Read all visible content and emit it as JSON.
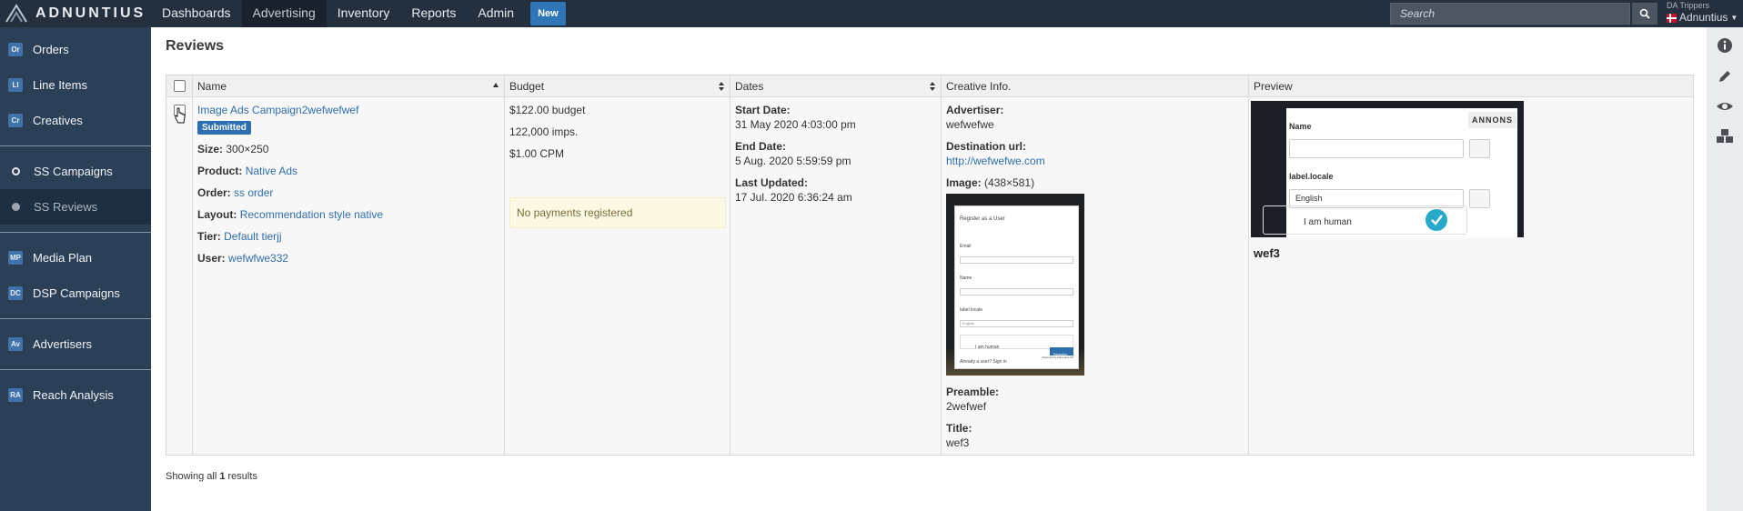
{
  "brand": {
    "name": "ADNUNTIUS"
  },
  "nav": {
    "items": [
      "Dashboards",
      "Advertising",
      "Inventory",
      "Reports",
      "Admin"
    ],
    "new_label": "New"
  },
  "search": {
    "placeholder": "Search"
  },
  "network": {
    "label": "DA Trippers",
    "name": "Adnuntius"
  },
  "sidebar": {
    "group1": [
      {
        "abbr": "Or",
        "label": "Orders"
      },
      {
        "abbr": "LI",
        "label": "Line Items"
      },
      {
        "abbr": "Cr",
        "label": "Creatives"
      }
    ],
    "group2": [
      {
        "label": "SS Campaigns"
      },
      {
        "label": "SS Reviews"
      }
    ],
    "group3": [
      {
        "abbr": "MP",
        "label": "Media Plan"
      },
      {
        "abbr": "DC",
        "label": "DSP Campaigns"
      }
    ],
    "group4": [
      {
        "abbr": "Av",
        "label": "Advertisers"
      }
    ],
    "group5": [
      {
        "abbr": "RA",
        "label": "Reach Analysis"
      }
    ]
  },
  "page": {
    "title": "Reviews"
  },
  "table": {
    "headers": {
      "name": "Name",
      "budget": "Budget",
      "dates": "Dates",
      "creative": "Creative Info.",
      "preview": "Preview"
    },
    "row": {
      "name": "Image Ads Campaign2wefwefwef",
      "status": "Submitted",
      "size_label": "Size:",
      "size": "300×250",
      "product_label": "Product:",
      "product": "Native Ads",
      "order_label": "Order:",
      "order": "ss order",
      "layout_label": "Layout:",
      "layout": "Recommendation style native",
      "tier_label": "Tier:",
      "tier": "Default tierjj",
      "user_label": "User:",
      "user": "wefwfwe332",
      "budget": "$122.00 budget",
      "imps": "122,000 imps.",
      "cpm": "$1.00 CPM",
      "payments": "No payments registered",
      "start_label": "Start Date:",
      "start": "31 May 2020 4:03:00 pm",
      "end_label": "End Date:",
      "end": "5 Aug. 2020 5:59:59 pm",
      "updated_label": "Last Updated:",
      "updated": "17 Jul. 2020 6:36:24 am",
      "advertiser_label": "Advertiser:",
      "advertiser": "wefwefwe",
      "dest_label": "Destination url:",
      "dest": "http://wefwefwe.com",
      "image_label": "Image:",
      "image_dims": "(438×581)",
      "preamble_label": "Preamble:",
      "preamble": "2wefwef",
      "title_label": "Title:",
      "title": "wef3",
      "thumb": {
        "heading": "Register as a User",
        "email": "Email",
        "name": "Name",
        "locale": "label.locale",
        "locale_value": "English",
        "human": "I am human",
        "already": "Already a user? Sign in",
        "register": "Register",
        "powered": "Powered by Adnuntius AS"
      },
      "preview": {
        "annons": "ANNONS",
        "name_label": "Name",
        "locale_label": "label.locale",
        "locale_value": "English",
        "human": "I am human",
        "title": "wef3"
      }
    }
  },
  "footer": {
    "prefix": "Showing all ",
    "count": "1",
    "suffix": " results"
  }
}
